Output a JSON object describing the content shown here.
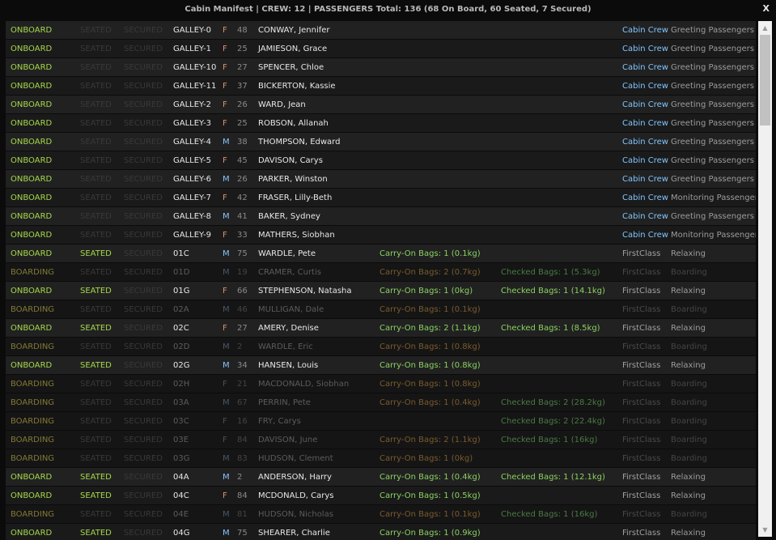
{
  "window": {
    "title": "Cabin Manifest | CREW: 12 |  PASSENGERS Total: 136 (68 On Board, 60 Seated, 7 Secured)",
    "close_label": "X"
  },
  "scrollbar": {
    "up_glyph": "▲",
    "down_glyph": "▼"
  },
  "colors": {
    "onboard": "#a6d84a",
    "boarding": "#827a36",
    "crew": "#82c5ff",
    "female": "#dd8f72",
    "male": "#88c3ff"
  },
  "rows": [
    {
      "status": "ONBOARD",
      "seated": "SEATED",
      "secured": "SECURED",
      "seat": "GALLEY-0",
      "gender": "F",
      "age": "48",
      "name": "CONWAY, Jennifer",
      "carry_on": "",
      "checked": "",
      "role": "Cabin Crew",
      "activity": "Greeting Passengers",
      "type": "crew"
    },
    {
      "status": "ONBOARD",
      "seated": "SEATED",
      "secured": "SECURED",
      "seat": "GALLEY-1",
      "gender": "F",
      "age": "25",
      "name": "JAMIESON, Grace",
      "carry_on": "",
      "checked": "",
      "role": "Cabin Crew",
      "activity": "Greeting Passengers",
      "type": "crew"
    },
    {
      "status": "ONBOARD",
      "seated": "SEATED",
      "secured": "SECURED",
      "seat": "GALLEY-10",
      "gender": "F",
      "age": "27",
      "name": "SPENCER, Chloe",
      "carry_on": "",
      "checked": "",
      "role": "Cabin Crew",
      "activity": "Greeting Passengers",
      "type": "crew"
    },
    {
      "status": "ONBOARD",
      "seated": "SEATED",
      "secured": "SECURED",
      "seat": "GALLEY-11",
      "gender": "F",
      "age": "37",
      "name": "BICKERTON, Kassie",
      "carry_on": "",
      "checked": "",
      "role": "Cabin Crew",
      "activity": "Greeting Passengers",
      "type": "crew"
    },
    {
      "status": "ONBOARD",
      "seated": "SEATED",
      "secured": "SECURED",
      "seat": "GALLEY-2",
      "gender": "F",
      "age": "26",
      "name": "WARD, Jean",
      "carry_on": "",
      "checked": "",
      "role": "Cabin Crew",
      "activity": "Greeting Passengers",
      "type": "crew"
    },
    {
      "status": "ONBOARD",
      "seated": "SEATED",
      "secured": "SECURED",
      "seat": "GALLEY-3",
      "gender": "F",
      "age": "25",
      "name": "ROBSON, Allanah",
      "carry_on": "",
      "checked": "",
      "role": "Cabin Crew",
      "activity": "Greeting Passengers",
      "type": "crew"
    },
    {
      "status": "ONBOARD",
      "seated": "SEATED",
      "secured": "SECURED",
      "seat": "GALLEY-4",
      "gender": "M",
      "age": "38",
      "name": "THOMPSON, Edward",
      "carry_on": "",
      "checked": "",
      "role": "Cabin Crew",
      "activity": "Greeting Passengers",
      "type": "crew"
    },
    {
      "status": "ONBOARD",
      "seated": "SEATED",
      "secured": "SECURED",
      "seat": "GALLEY-5",
      "gender": "F",
      "age": "45",
      "name": "DAVISON, Carys",
      "carry_on": "",
      "checked": "",
      "role": "Cabin Crew",
      "activity": "Greeting Passengers",
      "type": "crew"
    },
    {
      "status": "ONBOARD",
      "seated": "SEATED",
      "secured": "SECURED",
      "seat": "GALLEY-6",
      "gender": "M",
      "age": "26",
      "name": "PARKER, Winston",
      "carry_on": "",
      "checked": "",
      "role": "Cabin Crew",
      "activity": "Greeting Passengers",
      "type": "crew"
    },
    {
      "status": "ONBOARD",
      "seated": "SEATED",
      "secured": "SECURED",
      "seat": "GALLEY-7",
      "gender": "F",
      "age": "42",
      "name": "FRASER, Lilly-Beth",
      "carry_on": "",
      "checked": "",
      "role": "Cabin Crew",
      "activity": "Monitoring Passengers",
      "type": "crew"
    },
    {
      "status": "ONBOARD",
      "seated": "SEATED",
      "secured": "SECURED",
      "seat": "GALLEY-8",
      "gender": "M",
      "age": "41",
      "name": "BAKER, Sydney",
      "carry_on": "",
      "checked": "",
      "role": "Cabin Crew",
      "activity": "Greeting Passengers",
      "type": "crew"
    },
    {
      "status": "ONBOARD",
      "seated": "SEATED",
      "secured": "SECURED",
      "seat": "GALLEY-9",
      "gender": "F",
      "age": "33",
      "name": "MATHERS, Siobhan",
      "carry_on": "",
      "checked": "",
      "role": "Cabin Crew",
      "activity": "Monitoring Passengers",
      "type": "crew"
    },
    {
      "status": "ONBOARD",
      "seated": "SEATED",
      "secured": "SECURED",
      "seat": "01C",
      "gender": "M",
      "age": "75",
      "name": "WARDLE, Pete",
      "carry_on": "Carry-On Bags: 1 (0.1kg)",
      "checked": "",
      "role": "FirstClass",
      "activity": "Relaxing",
      "type": "seated"
    },
    {
      "status": "BOARDING",
      "seated": "SEATED",
      "secured": "SECURED",
      "seat": "01D",
      "gender": "M",
      "age": "19",
      "name": "CRAMER, Curtis",
      "carry_on": "Carry-On Bags: 2 (0.7kg)",
      "checked": "Checked Bags: 1 (5.3kg)",
      "role": "FirstClass",
      "activity": "Boarding",
      "type": "boarding"
    },
    {
      "status": "ONBOARD",
      "seated": "SEATED",
      "secured": "SECURED",
      "seat": "01G",
      "gender": "F",
      "age": "66",
      "name": "STEPHENSON, Natasha",
      "carry_on": "Carry-On Bags: 1 (0kg)",
      "checked": "Checked Bags: 1 (14.1kg)",
      "role": "FirstClass",
      "activity": "Relaxing",
      "type": "seated"
    },
    {
      "status": "BOARDING",
      "seated": "SEATED",
      "secured": "SECURED",
      "seat": "02A",
      "gender": "M",
      "age": "46",
      "name": "MULLIGAN, Dale",
      "carry_on": "Carry-On Bags: 1 (0.1kg)",
      "checked": "",
      "role": "FirstClass",
      "activity": "Boarding",
      "type": "boarding"
    },
    {
      "status": "ONBOARD",
      "seated": "SEATED",
      "secured": "SECURED",
      "seat": "02C",
      "gender": "F",
      "age": "27",
      "name": "AMERY, Denise",
      "carry_on": "Carry-On Bags: 2 (1.1kg)",
      "checked": "Checked Bags: 1 (8.5kg)",
      "role": "FirstClass",
      "activity": "Relaxing",
      "type": "seated"
    },
    {
      "status": "BOARDING",
      "seated": "SEATED",
      "secured": "SECURED",
      "seat": "02D",
      "gender": "M",
      "age": "2",
      "name": "WARDLE, Eric",
      "carry_on": "Carry-On Bags: 1 (0.8kg)",
      "checked": "",
      "role": "FirstClass",
      "activity": "Boarding",
      "type": "boarding"
    },
    {
      "status": "ONBOARD",
      "seated": "SEATED",
      "secured": "SECURED",
      "seat": "02G",
      "gender": "M",
      "age": "34",
      "name": "HANSEN, Louis",
      "carry_on": "Carry-On Bags: 1 (0.8kg)",
      "checked": "",
      "role": "FirstClass",
      "activity": "Relaxing",
      "type": "seated"
    },
    {
      "status": "BOARDING",
      "seated": "SEATED",
      "secured": "SECURED",
      "seat": "02H",
      "gender": "F",
      "age": "21",
      "name": "MACDONALD, Siobhan",
      "carry_on": "Carry-On Bags: 1 (0.8kg)",
      "checked": "",
      "role": "FirstClass",
      "activity": "Boarding",
      "type": "boarding"
    },
    {
      "status": "BOARDING",
      "seated": "SEATED",
      "secured": "SECURED",
      "seat": "03A",
      "gender": "M",
      "age": "67",
      "name": "PERRIN, Pete",
      "carry_on": "Carry-On Bags: 1 (0.4kg)",
      "checked": "Checked Bags: 2 (28.2kg)",
      "role": "FirstClass",
      "activity": "Boarding",
      "type": "boarding"
    },
    {
      "status": "BOARDING",
      "seated": "SEATED",
      "secured": "SECURED",
      "seat": "03C",
      "gender": "F",
      "age": "16",
      "name": "FRY, Carys",
      "carry_on": "",
      "checked": "Checked Bags: 2 (22.4kg)",
      "role": "FirstClass",
      "activity": "Boarding",
      "type": "boarding"
    },
    {
      "status": "BOARDING",
      "seated": "SEATED",
      "secured": "SECURED",
      "seat": "03E",
      "gender": "F",
      "age": "84",
      "name": "DAVISON, June",
      "carry_on": "Carry-On Bags: 2 (1.1kg)",
      "checked": "Checked Bags: 1 (16kg)",
      "role": "FirstClass",
      "activity": "Boarding",
      "type": "boarding"
    },
    {
      "status": "BOARDING",
      "seated": "SEATED",
      "secured": "SECURED",
      "seat": "03G",
      "gender": "M",
      "age": "83",
      "name": "HUDSON, Clement",
      "carry_on": "Carry-On Bags: 1 (0kg)",
      "checked": "",
      "role": "FirstClass",
      "activity": "Boarding",
      "type": "boarding"
    },
    {
      "status": "ONBOARD",
      "seated": "SEATED",
      "secured": "SECURED",
      "seat": "04A",
      "gender": "M",
      "age": "2",
      "name": "ANDERSON, Harry",
      "carry_on": "Carry-On Bags: 1 (0.4kg)",
      "checked": "Checked Bags: 1 (12.1kg)",
      "role": "FirstClass",
      "activity": "Relaxing",
      "type": "seated"
    },
    {
      "status": "ONBOARD",
      "seated": "SEATED",
      "secured": "SECURED",
      "seat": "04C",
      "gender": "F",
      "age": "84",
      "name": "MCDONALD, Carys",
      "carry_on": "Carry-On Bags: 1 (0.5kg)",
      "checked": "",
      "role": "FirstClass",
      "activity": "Relaxing",
      "type": "seated"
    },
    {
      "status": "BOARDING",
      "seated": "SEATED",
      "secured": "SECURED",
      "seat": "04E",
      "gender": "M",
      "age": "81",
      "name": "HUDSON, Nicholas",
      "carry_on": "Carry-On Bags: 1 (0.1kg)",
      "checked": "Checked Bags: 1 (16kg)",
      "role": "FirstClass",
      "activity": "Boarding",
      "type": "boarding"
    },
    {
      "status": "ONBOARD",
      "seated": "SEATED",
      "secured": "SECURED",
      "seat": "04G",
      "gender": "M",
      "age": "75",
      "name": "SHEARER, Charlie",
      "carry_on": "Carry-On Bags: 1 (0.9kg)",
      "checked": "",
      "role": "FirstClass",
      "activity": "Relaxing",
      "type": "seated"
    }
  ]
}
